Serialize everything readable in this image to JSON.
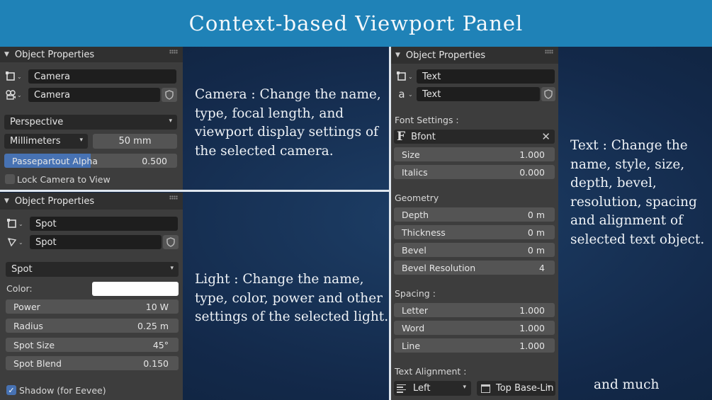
{
  "banner": {
    "title": "Context-based Viewport Panel"
  },
  "header_label": "Object Properties",
  "camera_panel": {
    "object_name": "Camera",
    "data_name": "Camera",
    "projection": "Perspective",
    "lens_unit": "Millimeters",
    "focal_length": "50 mm",
    "passepartout_label": "Passepartout Alpha",
    "passepartout_value": "0.500",
    "passepartout_fill": 0.5,
    "lock_label": "Lock Camera to View",
    "lock_checked": false
  },
  "light_panel": {
    "object_name": "Spot",
    "data_name": "Spot",
    "light_type": "Spot",
    "color_label": "Color:",
    "color_value": "#ffffff",
    "power_label": "Power",
    "power_value": "10 W",
    "radius_label": "Radius",
    "radius_value": "0.25 m",
    "spot_size_label": "Spot Size",
    "spot_size_value": "45°",
    "spot_blend_label": "Spot Blend",
    "spot_blend_value": "0.150",
    "shadow_label": "Shadow (for Eevee)",
    "shadow_checked": true
  },
  "text_panel": {
    "object_name": "Text",
    "data_name": "Text",
    "font_settings_label": "Font Settings :",
    "font_name": "Bfont",
    "size_label": "Size",
    "size_value": "1.000",
    "italics_label": "Italics",
    "italics_value": "0.000",
    "geometry_label": "Geometry",
    "depth_label": "Depth",
    "depth_value": "0 m",
    "thickness_label": "Thickness",
    "thickness_value": "0 m",
    "bevel_label": "Bevel",
    "bevel_value": "0 m",
    "bevel_res_label": "Bevel Resolution",
    "bevel_res_value": "4",
    "spacing_label": "Spacing :",
    "letter_label": "Letter",
    "letter_value": "1.000",
    "word_label": "Word",
    "word_value": "1.000",
    "line_label": "Line",
    "line_value": "1.000",
    "alignment_label": "Text Alignment :",
    "align_h": "Left",
    "align_v": "Top Base-Lin"
  },
  "descriptions": {
    "camera": "Camera : Change the name,\ntype,  focal length, and\nviewport display settings of\nthe selected camera.",
    "light": "Light : Change the name,\ntype, color, power and other\nsettings of the selected light.",
    "text": "Text : Change the\nname, style, size,\ndepth, bevel,\nresolution, spacing\nand alignment of\nselected text object.",
    "more": "and much more...."
  }
}
